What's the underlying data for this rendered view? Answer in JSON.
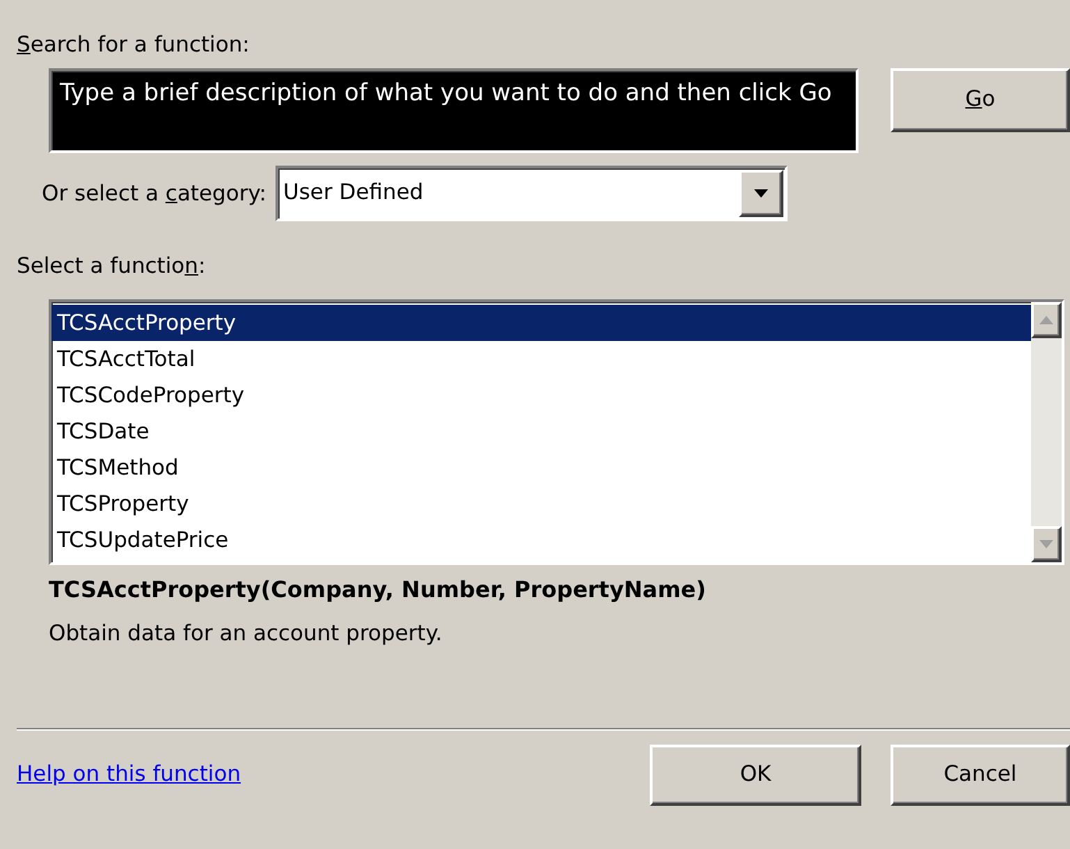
{
  "search": {
    "label": {
      "key": "S",
      "post": "earch for a function:"
    },
    "value": "Type a brief description of what you want to do and then click Go",
    "value_selected": true
  },
  "go_button": {
    "key": "G",
    "post": "o"
  },
  "category": {
    "label": {
      "pre": "Or select a ",
      "key": "c",
      "post": "ategory:"
    },
    "value": "User Defined"
  },
  "functions": {
    "label": {
      "pre": "Select a functio",
      "key": "n",
      "post": ":"
    },
    "items": [
      {
        "name": "TCSAcctProperty",
        "selected": true
      },
      {
        "name": "TCSAcctTotal",
        "selected": false
      },
      {
        "name": "TCSCodeProperty",
        "selected": false
      },
      {
        "name": "TCSDate",
        "selected": false
      },
      {
        "name": "TCSMethod",
        "selected": false
      },
      {
        "name": "TCSProperty",
        "selected": false
      },
      {
        "name": "TCSUpdatePrice",
        "selected": false
      }
    ]
  },
  "signature": "TCSAcctProperty(Company, Number, PropertyName)",
  "description": "Obtain data for an account property.",
  "help_link": "Help on this function",
  "buttons": [
    "OK",
    "Cancel"
  ]
}
